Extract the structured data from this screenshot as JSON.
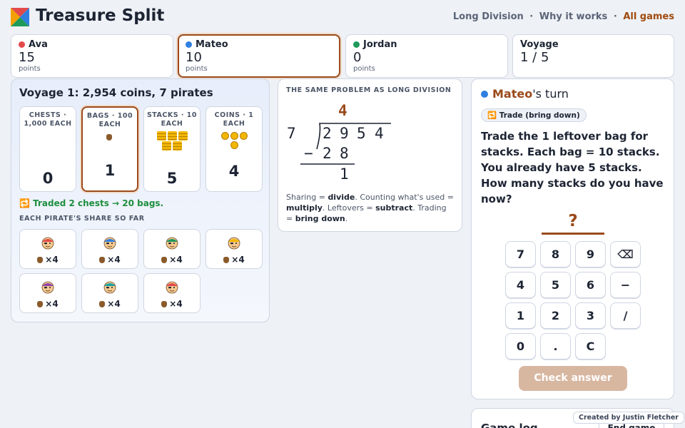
{
  "app": {
    "title": "Treasure Split"
  },
  "nav": {
    "items": [
      "Long Division",
      "Why it works",
      "All games"
    ],
    "separator": "·",
    "active_index": 2
  },
  "scores": [
    {
      "name": "Ava",
      "value": "15",
      "unit": "points",
      "color": "#e24a4a"
    },
    {
      "name": "Mateo",
      "value": "10",
      "unit": "points",
      "color": "#2f7fe0"
    },
    {
      "name": "Jordan",
      "value": "0",
      "unit": "points",
      "color": "#1e9a5a"
    }
  ],
  "voyage_card": {
    "label": "Voyage",
    "value": "1 / 5"
  },
  "board": {
    "title": "Voyage 1: 2,954 coins, 7 pirates",
    "denominations": [
      {
        "label": "CHESTS · 1,000 EACH",
        "count": "0",
        "icon": "chest-icon"
      },
      {
        "label": "BAGS · 100 EACH",
        "count": "1",
        "icon": "bag-icon"
      },
      {
        "label": "STACKS · 10 EACH",
        "count": "5",
        "icon": "stack-icon"
      },
      {
        "label": "COINS · 1 EACH",
        "count": "4",
        "icon": "coin-icon"
      }
    ],
    "trade_message": "🔁 Traded 2 chests → 20 bags.",
    "share_label": "EACH PIRATE'S SHARE SO FAR",
    "pirates": [
      {
        "share": "×4",
        "bandana": "#e24a4a"
      },
      {
        "share": "×4",
        "bandana": "#2f7fe0"
      },
      {
        "share": "×4",
        "bandana": "#1e9a5a"
      },
      {
        "share": "×4",
        "bandana": "#f2b705"
      },
      {
        "share": "×4",
        "bandana": "#8e44ad"
      },
      {
        "share": "×4",
        "bandana": "#17a2a2"
      },
      {
        "share": "×4",
        "bandana": "#e24a4a"
      }
    ]
  },
  "long_division": {
    "label": "THE SAME PROBLEM AS LONG DIVISION",
    "divisor": "7",
    "dividend": [
      "2",
      "9",
      "5",
      "4"
    ],
    "quotient": "4",
    "subtract_sign": "−",
    "product": [
      "2",
      "8"
    ],
    "remainder": "1",
    "note": {
      "t1": "Sharing = ",
      "b1": "divide",
      "t2": ". Counting what's used = ",
      "b2": "multiply",
      "t3": ". Leftovers = ",
      "b3": "subtract",
      "t4": ". Trading = ",
      "b4": "bring down",
      "t5": "."
    }
  },
  "turn": {
    "player": "Mateo",
    "suffix": "'s turn",
    "mode": "🔁 Trade (bring down)",
    "prompt": "Trade the 1 leftover bag for stacks. Each bag = 10 stacks. You already have 5 stacks. How many stacks do you have now?",
    "answer": "?"
  },
  "keypad": [
    [
      "7",
      "8",
      "9",
      "⌫"
    ],
    [
      "4",
      "5",
      "6",
      "−"
    ],
    [
      "1",
      "2",
      "3",
      "/"
    ],
    [
      "0",
      ".",
      "C"
    ]
  ],
  "check_label": "Check answer",
  "log": {
    "title": "Game log",
    "end_label": "End game"
  },
  "credit": "Created by Justin Fletcher",
  "colors": {
    "accent": "#9a4a1a",
    "success": "#1e8e3e",
    "check_disabled": "#d8b7a1"
  }
}
